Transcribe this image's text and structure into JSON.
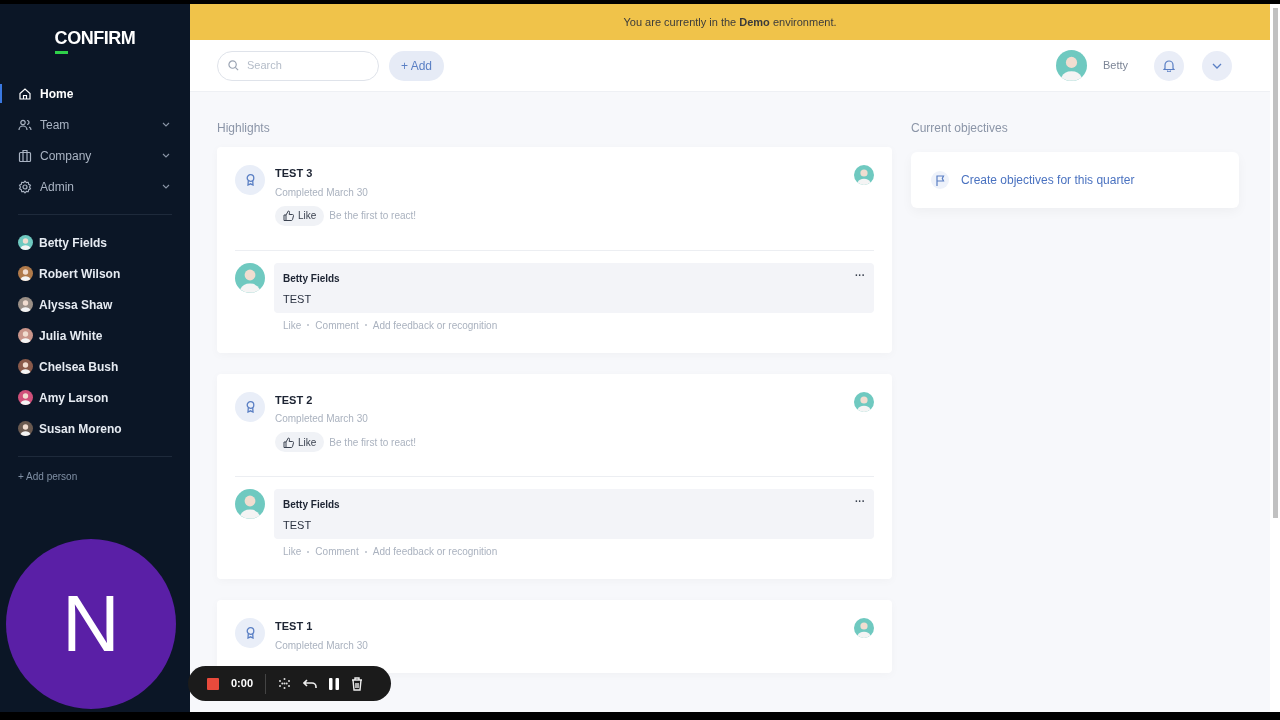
{
  "logo": "CONFIRM",
  "banner": "You are currently in the **Demo** environment.",
  "nav": [
    {
      "label": "Home",
      "selected": true,
      "expandable": false
    },
    {
      "label": "Team",
      "selected": false,
      "expandable": true
    },
    {
      "label": "Company",
      "selected": false,
      "expandable": true
    },
    {
      "label": "Admin",
      "selected": false,
      "expandable": true
    }
  ],
  "people": [
    {
      "name": "Betty Fields",
      "color": "#6fc9c0"
    },
    {
      "name": "Robert Wilson",
      "color": "#b07a4a"
    },
    {
      "name": "Alyssa Shaw",
      "color": "#9a8f86"
    },
    {
      "name": "Julia White",
      "color": "#c9958a"
    },
    {
      "name": "Chelsea Bush",
      "color": "#8a5a4a"
    },
    {
      "name": "Amy Larson",
      "color": "#d0507a"
    },
    {
      "name": "Susan Moreno",
      "color": "#6a5a50"
    }
  ],
  "add_person": "+ Add person",
  "search": {
    "placeholder": "Search"
  },
  "add_button": "+ Add",
  "user": {
    "name": "Betty"
  },
  "highlights_title": "Highlights",
  "highlights": [
    {
      "title": "TEST 3",
      "subtitle": "Completed March 30",
      "like": "Like",
      "reaction_hint": "Be the first to react!",
      "comment": {
        "author": "Betty Fields",
        "text": "TEST",
        "more": "···",
        "actions": [
          "Like",
          "Comment",
          "Add feedback or recognition"
        ]
      }
    },
    {
      "title": "TEST 2",
      "subtitle": "Completed March 30",
      "like": "Like",
      "reaction_hint": "Be the first to react!",
      "comment": {
        "author": "Betty Fields",
        "text": "TEST",
        "more": "···",
        "actions": [
          "Like",
          "Comment",
          "Add feedback or recognition"
        ]
      }
    },
    {
      "title": "TEST 1",
      "subtitle": "Completed March 30"
    }
  ],
  "objectives_title": "Current objectives",
  "objectives_link": "Create objectives for this quarter",
  "presenter_badge": "N",
  "recorder": {
    "time": "0:00"
  }
}
